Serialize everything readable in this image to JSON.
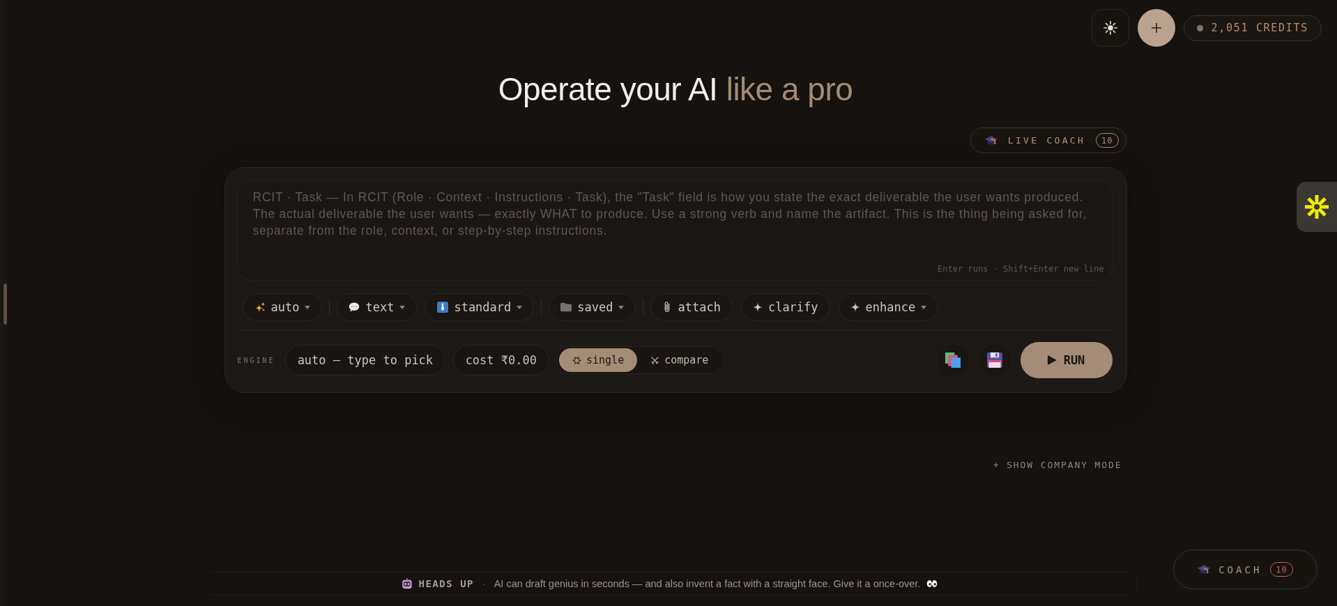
{
  "header": {
    "credits": "2,051 CREDITS"
  },
  "headline": {
    "text": "Operate your AI",
    "accent": "like a pro"
  },
  "live_coach": {
    "label": "LIVE COACH",
    "count": "10"
  },
  "composer": {
    "prompt": {
      "placeholder": "RCIT · Task — In RCIT (Role · Context · Instructions · Task), the \"Task\" field is how you state the exact deliverable the user wants produced. The actual deliverable the user wants — exactly WHAT to produce. Use a strong verb and name the artifact. This is the thing being asked for, separate from the role, context, or step-by-step instructions.",
      "hint": "Enter runs · Shift+Enter new line"
    },
    "tool_groups": [
      [
        {
          "label": "auto",
          "kind": "menu"
        }
      ],
      [
        {
          "label": "text",
          "kind": "menu"
        },
        {
          "label": "standard",
          "kind": "menu"
        }
      ],
      [
        {
          "label": "saved",
          "kind": "menu"
        }
      ],
      [
        {
          "label": "attach",
          "kind": "action"
        },
        {
          "label": "clarify",
          "kind": "action"
        },
        {
          "label": "enhance",
          "kind": "menu"
        }
      ]
    ],
    "engine": {
      "label": "ENGINE",
      "placeholder": "auto — type to pick"
    },
    "cost": "cost ₹0.00",
    "modes": [
      {
        "label": "single",
        "selected": true
      },
      {
        "label": "compare",
        "selected": false
      }
    ],
    "run": "RUN"
  },
  "company_mode": "+ SHOW COMPANY MODE",
  "heads_up": {
    "title": "HEADS UP",
    "separator": "·",
    "message": "AI can draft genius in seconds — and also invent a fact with a straight face. Give it a once-over."
  },
  "coach": {
    "label": "COACH",
    "count": "10"
  }
}
